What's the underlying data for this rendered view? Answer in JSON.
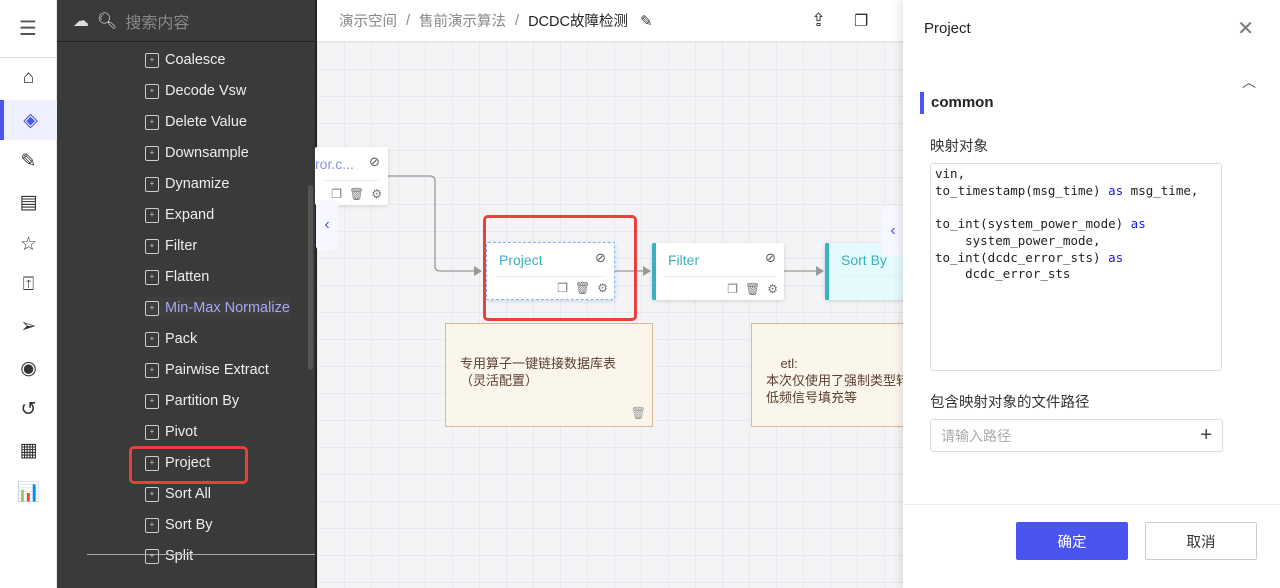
{
  "rail": {
    "icons": [
      "collapse-menu-icon",
      "home-icon",
      "layers-icon",
      "edit-note-icon",
      "report-icon",
      "star-icon",
      "folder-upload-icon",
      "send-icon",
      "broadcast-icon",
      "history-icon",
      "schedule-icon",
      "bar-chart-icon"
    ]
  },
  "panel": {
    "search_placeholder": "搜索内容",
    "items": [
      "Coalesce",
      "Decode Vsw",
      "Delete Value",
      "Downsample",
      "Dynamize",
      "Expand",
      "Filter",
      "Flatten",
      "Min-Max Normalize",
      "Pack",
      "Pairwise Extract",
      "Partition By",
      "Pivot",
      "Project",
      "Sort All",
      "Sort By",
      "Split"
    ],
    "hover_item": "Min-Max Normalize",
    "highlighted_item": "Project"
  },
  "breadcrumb": {
    "items": [
      "演示空间",
      "售前演示算法",
      "DCDC故障检测"
    ],
    "separator": "/"
  },
  "canvas": {
    "nodes": [
      {
        "name": "ror.c..."
      },
      {
        "name": "Project"
      },
      {
        "name": "Filter"
      },
      {
        "name": "Sort By"
      }
    ],
    "notes": [
      {
        "text": "专用算子一键链接数据库表\n（灵活配置）"
      },
      {
        "text": "etl:\n本次仅使用了强制类型转\n低频信号填充等"
      }
    ]
  },
  "drawer": {
    "title": "Project",
    "section": "common",
    "mapping_label": "映射对象",
    "mapping_lines": [
      [
        "vin,",
        ""
      ],
      [
        "to_timestamp(msg_time) ",
        "as",
        " msg_time,"
      ],
      [
        ""
      ],
      [
        "to_int(system_power_mode) ",
        "as"
      ],
      [
        "    system_power_mode,"
      ],
      [
        "to_int(dcdc_error_sts) ",
        "as"
      ],
      [
        "    dcdc_error_sts"
      ]
    ],
    "path_label": "包含映射对象的文件路径",
    "path_placeholder": "请输入路径",
    "ok_label": "确定",
    "cancel_label": "取消"
  },
  "colors": {
    "accent": "#4a55f0",
    "highlight": "#e9403b",
    "node_teal": "#3bb0bf"
  }
}
